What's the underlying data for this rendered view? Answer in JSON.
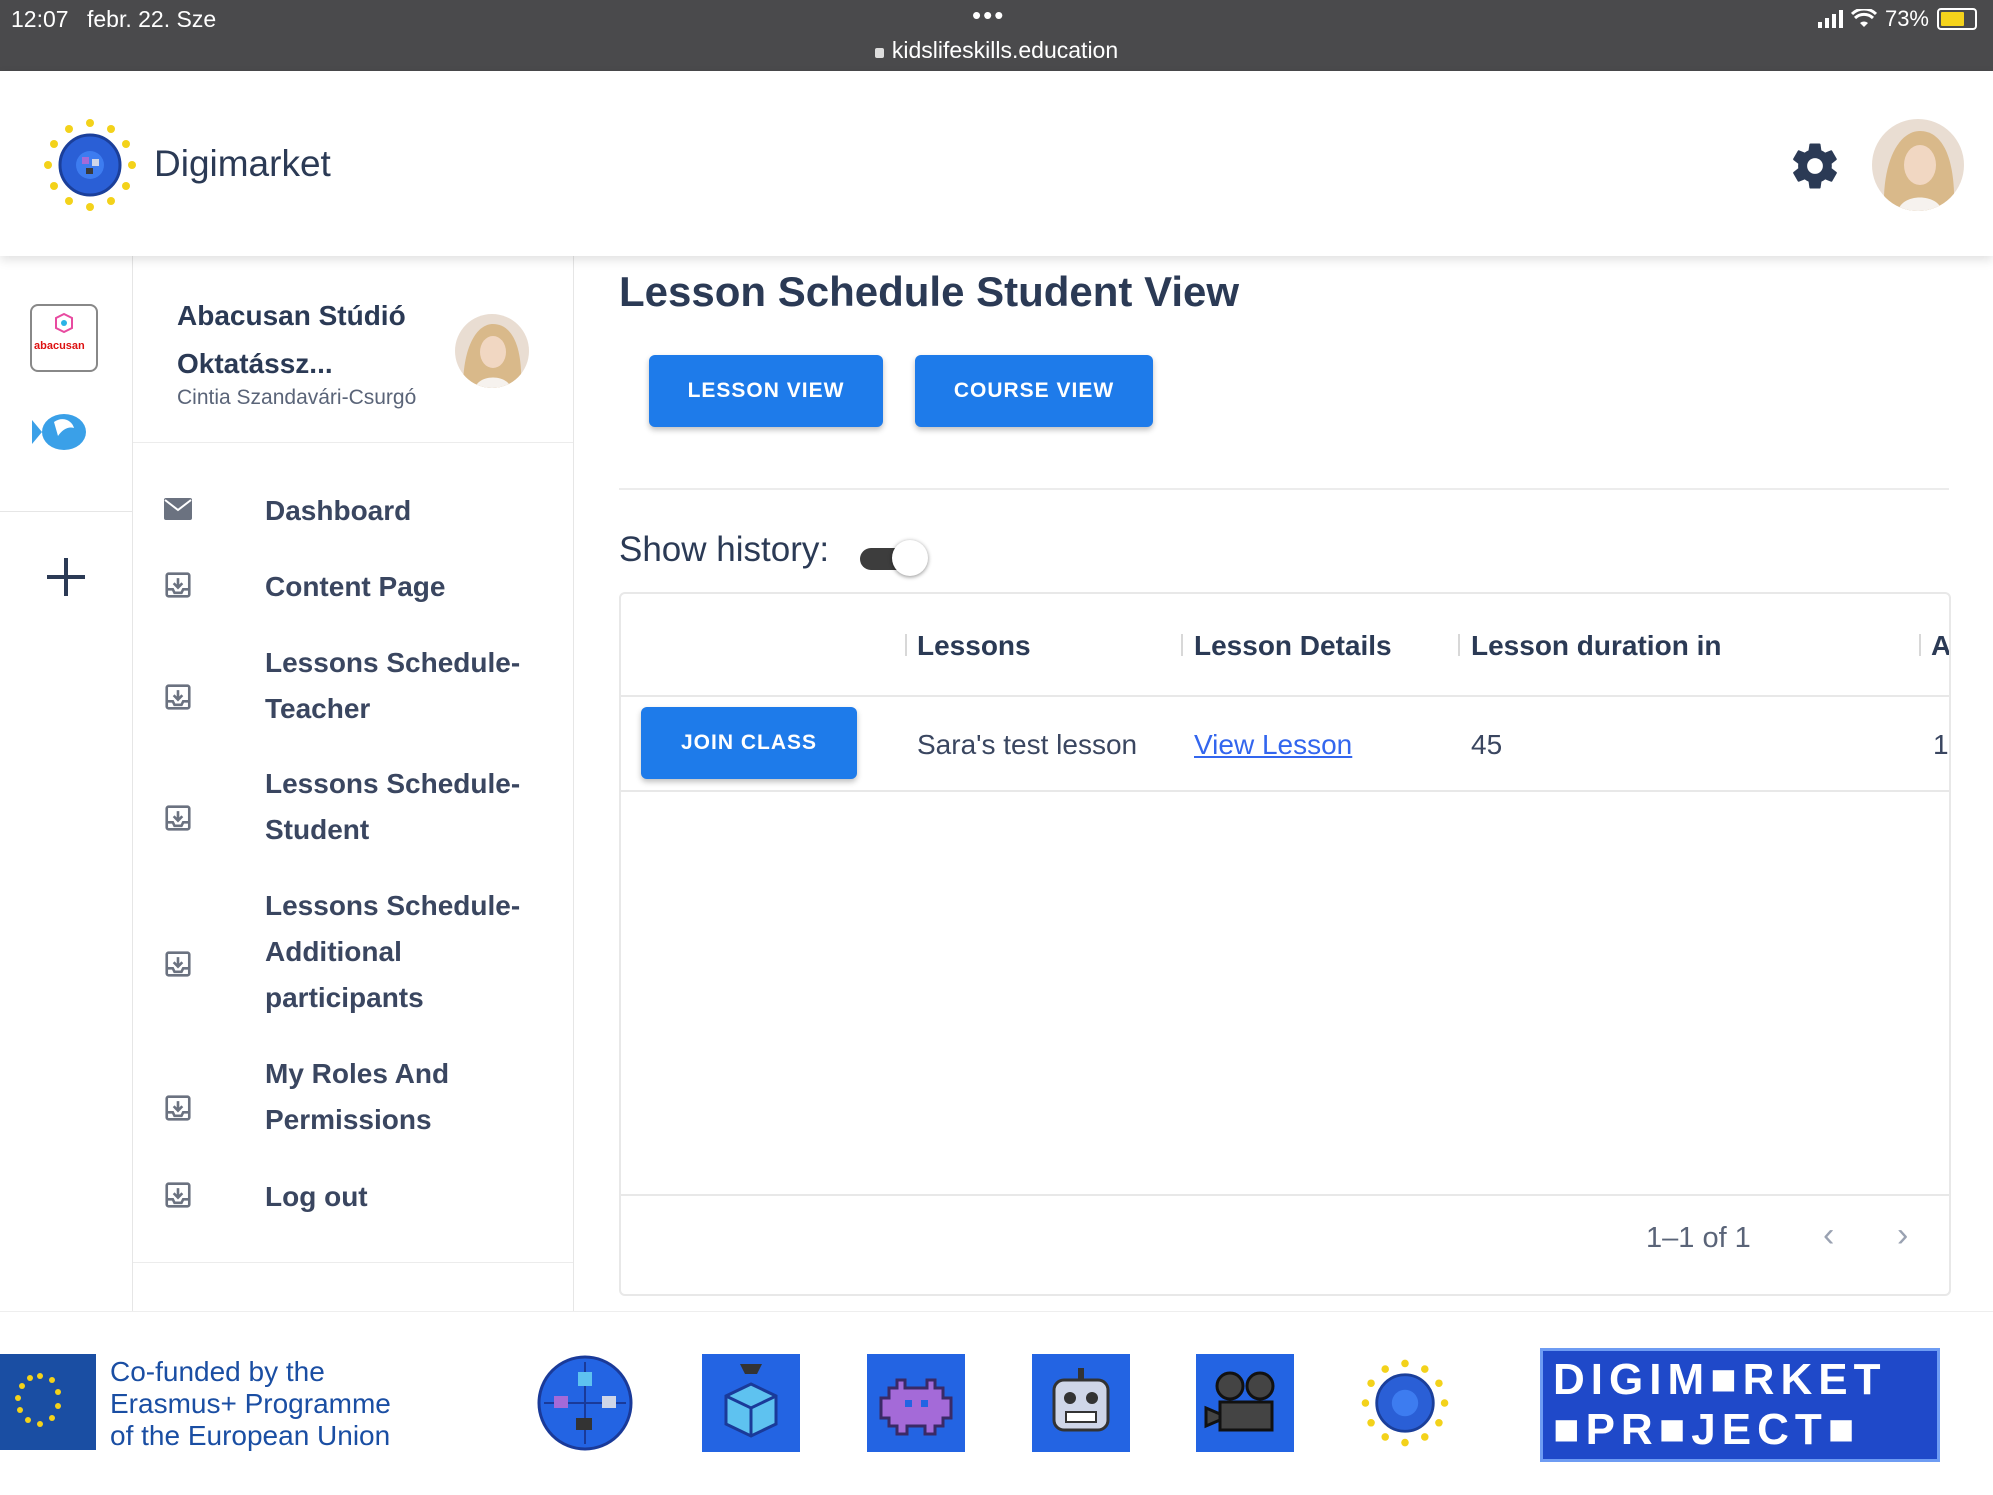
{
  "status_bar": {
    "time": "12:07",
    "date": "febr. 22. Sze",
    "dots": "•••",
    "url": "kidslifeskills.education",
    "battery": "73%"
  },
  "header": {
    "brand": "Digimarket",
    "settings_icon": "gear-icon",
    "avatar": "user-avatar"
  },
  "rail": {
    "org_icon_text": "abacusan",
    "add_icon": "plus-icon"
  },
  "sidebar": {
    "org_name": "Abacusan Stúdió Oktatássz...",
    "user_name": "Cintia Szandavári-Csurgó",
    "items": [
      {
        "label": "Dashboard",
        "icon": "mail-icon"
      },
      {
        "label": "Content Page",
        "icon": "inbox-download-icon"
      },
      {
        "label": "Lessons Schedule-Teacher",
        "icon": "inbox-download-icon"
      },
      {
        "label": "Lessons Schedule-Student",
        "icon": "inbox-download-icon"
      },
      {
        "label": "Lessons Schedule-Additional participants",
        "icon": "inbox-download-icon"
      },
      {
        "label": "My Roles And Permissions",
        "icon": "inbox-download-icon"
      },
      {
        "label": "Log out",
        "icon": "inbox-download-icon"
      }
    ]
  },
  "main": {
    "title": "Lesson Schedule Student View",
    "lesson_view_btn": "LESSON VIEW",
    "course_view_btn": "COURSE VIEW",
    "show_history_label": "Show history:",
    "show_history_on": true
  },
  "table": {
    "headers": [
      "Lessons",
      "Lesson Details",
      "Lesson duration in",
      "A"
    ],
    "rows": [
      {
        "action": "JOIN CLASS",
        "lesson": "Sara's test lesson",
        "details": "View Lesson",
        "duration": "45",
        "extra": "1"
      }
    ],
    "pagination": "1–1 of 1"
  },
  "footer": {
    "eu_text_1": "Co-funded by the",
    "eu_text_2": "Erasmus+ Programme",
    "eu_text_3": "of the European Union",
    "banner_line1": "DIGIM■RKET",
    "banner_line2": "■PR■JECT■",
    "colors": {
      "brand_blue": "#2364e3",
      "button_blue": "#1e7bea",
      "eu_blue": "#1a4ea3"
    }
  }
}
